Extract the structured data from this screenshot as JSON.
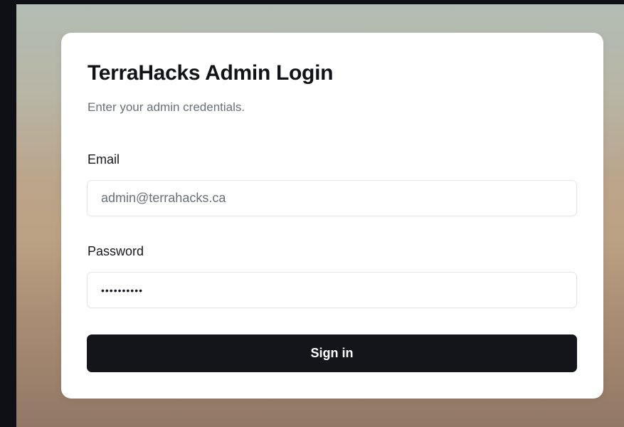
{
  "login": {
    "title": "TerraHacks Admin Login",
    "subtitle": "Enter your admin credentials.",
    "email": {
      "label": "Email",
      "placeholder": "admin@terrahacks.ca",
      "value": ""
    },
    "password": {
      "label": "Password",
      "value": "••••••••••"
    },
    "submit_label": "Sign in"
  },
  "colors": {
    "card_background": "#ffffff",
    "button_background": "#13151b",
    "button_text": "#ffffff",
    "title_text": "#111318",
    "muted_text": "#6b6f78"
  }
}
